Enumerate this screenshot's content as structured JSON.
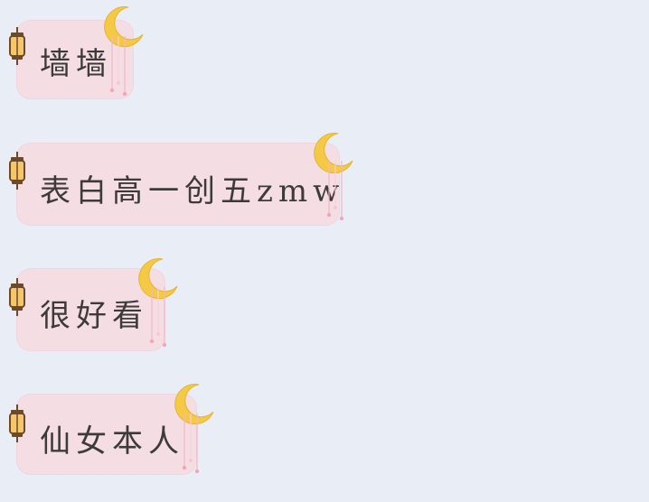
{
  "messages": [
    {
      "text": "墙墙"
    },
    {
      "text": "表白高一创五zmw"
    },
    {
      "text": "很好看"
    },
    {
      "text": "仙女本人"
    }
  ],
  "decor": {
    "bubble_color": "#f4dde3",
    "background_color": "#e9edf5",
    "text_color": "#3d3a3a",
    "moon_color": "#f3c945",
    "lantern_icon": "lantern-icon",
    "moon_icon": "crescent-moon-icon",
    "tassel_icon": "hanging-tassel-icon"
  }
}
